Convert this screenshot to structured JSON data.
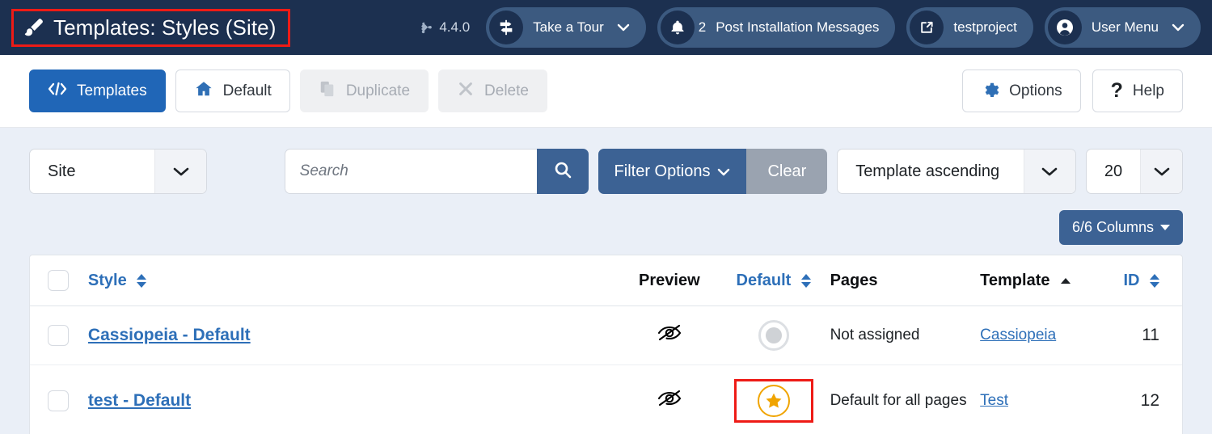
{
  "header": {
    "page_title": "Templates: Styles (Site)",
    "brush_icon": "paintbrush-icon",
    "version": "4.4.0",
    "joomla_icon": "joomla-logo-icon",
    "take_a_tour": {
      "label": "Take a Tour",
      "icon": "signpost-icon",
      "chevron": "chevron-down-icon"
    },
    "messages": {
      "count": "2",
      "label": "Post Installation Messages",
      "icon": "bell-icon"
    },
    "site_link": {
      "label": "testproject",
      "icon": "external-link-icon"
    },
    "user_menu": {
      "label": "User Menu",
      "icon": "user-circle-icon",
      "chevron": "chevron-down-icon"
    }
  },
  "toolbar": {
    "templates": {
      "label": "Templates",
      "icon": "code-icon",
      "state": "active"
    },
    "default": {
      "label": "Default",
      "icon": "home-icon",
      "state": "enabled"
    },
    "duplicate": {
      "label": "Duplicate",
      "icon": "copy-icon",
      "state": "disabled"
    },
    "delete": {
      "label": "Delete",
      "icon": "times-icon",
      "state": "disabled"
    },
    "options": {
      "label": "Options",
      "icon": "gear-icon",
      "state": "enabled"
    },
    "help": {
      "label": "Help",
      "icon": "question-mark-icon",
      "state": "enabled"
    }
  },
  "filters": {
    "client_select": {
      "value": "Site",
      "icon": "chevron-down-icon"
    },
    "search": {
      "value": "",
      "placeholder": "Search",
      "button_icon": "search-icon"
    },
    "filter_options": {
      "label": "Filter Options",
      "icon": "chevron-down-icon"
    },
    "clear": {
      "label": "Clear"
    },
    "sort_select": {
      "value": "Template ascending",
      "icon": "chevron-down-icon"
    },
    "limit_select": {
      "value": "20",
      "icon": "chevron-down-icon"
    },
    "columns_button": {
      "label": "6/6 Columns",
      "icon": "caret-down-icon"
    }
  },
  "table": {
    "columns": [
      {
        "key": "check",
        "label": "",
        "sortable": false
      },
      {
        "key": "style",
        "label": "Style",
        "sortable": true,
        "sort_state": "none"
      },
      {
        "key": "preview",
        "label": "Preview",
        "sortable": false
      },
      {
        "key": "default",
        "label": "Default",
        "sortable": true,
        "sort_state": "none"
      },
      {
        "key": "pages",
        "label": "Pages",
        "sortable": false
      },
      {
        "key": "template",
        "label": "Template",
        "sortable": true,
        "sort_state": "asc"
      },
      {
        "key": "id",
        "label": "ID",
        "sortable": true,
        "sort_state": "none"
      }
    ],
    "rows": [
      {
        "style": "Cassiopeia - Default",
        "preview_icon": "eye-slash-icon",
        "default_state": "not-default",
        "default_icon": "circle-icon",
        "pages": "Not assigned",
        "template": "Cassiopeia",
        "id": "11",
        "highlighted": false
      },
      {
        "style": "test - Default",
        "preview_icon": "eye-slash-icon",
        "default_state": "default",
        "default_icon": "star-icon",
        "pages": "Default for all pages",
        "template": "Test",
        "id": "12",
        "highlighted": true
      }
    ]
  },
  "colors": {
    "header_bg": "#1c3050",
    "primary_blue": "#2066b7",
    "link_blue": "#2d6fb8",
    "filter_blue": "#3c6294",
    "clear_gray": "#9aa3b0",
    "annotation_red": "#ee1b16",
    "star_gold": "#f0a400",
    "content_bg": "#eaeff7"
  }
}
